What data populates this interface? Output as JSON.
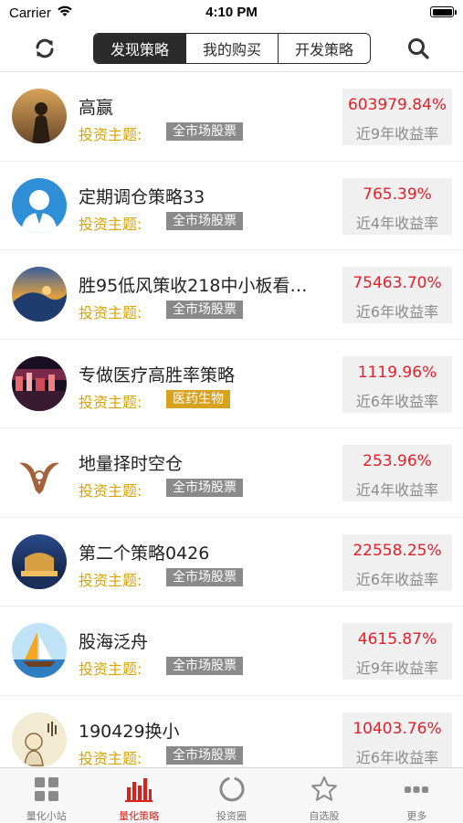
{
  "status_bar": {
    "carrier": "Carrier",
    "time": "4:10 PM"
  },
  "navbar": {
    "tabs": [
      {
        "label": "发现策略",
        "active": true
      },
      {
        "label": "我的购买",
        "active": false
      },
      {
        "label": "开发策略",
        "active": false
      }
    ]
  },
  "strategies": [
    {
      "name": "高赢",
      "theme_label": "投资主题:",
      "tag": "全市场股票",
      "return": "603979.84%",
      "period": "近9年收益率"
    },
    {
      "name": "定期调仓策略33",
      "theme_label": "投资主题:",
      "tag": "全市场股票",
      "return": "765.39%",
      "period": "近4年收益率"
    },
    {
      "name": "胜95低风策收218中小板看…",
      "theme_label": "投资主题:",
      "tag": "全市场股票",
      "return": "75463.70%",
      "period": "近6年收益率"
    },
    {
      "name": "专做医疗高胜率策略",
      "theme_label": "投资主题:",
      "tag": "医药生物",
      "return": "1119.96%",
      "period": "近6年收益率"
    },
    {
      "name": "地量择时空仓",
      "theme_label": "投资主题:",
      "tag": "全市场股票",
      "return": "253.96%",
      "period": "近4年收益率"
    },
    {
      "name": "第二个策略0426",
      "theme_label": "投资主题:",
      "tag": "全市场股票",
      "return": "22558.25%",
      "period": "近6年收益率"
    },
    {
      "name": "股海泛舟",
      "theme_label": "投资主题:",
      "tag": "全市场股票",
      "return": "4615.87%",
      "period": "近9年收益率"
    },
    {
      "name": "190429换小",
      "theme_label": "投资主题:",
      "tag": "全市场股票",
      "return": "10403.76%",
      "period": "近6年收益率"
    }
  ],
  "tabbar": {
    "items": [
      {
        "label": "量化小站",
        "icon": "grid-icon",
        "active": false
      },
      {
        "label": "量化策略",
        "icon": "bar-chart-icon",
        "active": true
      },
      {
        "label": "投资圈",
        "icon": "circle-icon",
        "active": false
      },
      {
        "label": "自选股",
        "icon": "star-icon",
        "active": false
      },
      {
        "label": "更多",
        "icon": "more-icon",
        "active": false
      }
    ]
  },
  "colors": {
    "accent_red": "#e4202a",
    "theme_gold": "#d9a400",
    "tag_gray": "#8a8a8a",
    "tag_gold": "#d8a21e",
    "segment_dark": "#2b2b2b"
  }
}
